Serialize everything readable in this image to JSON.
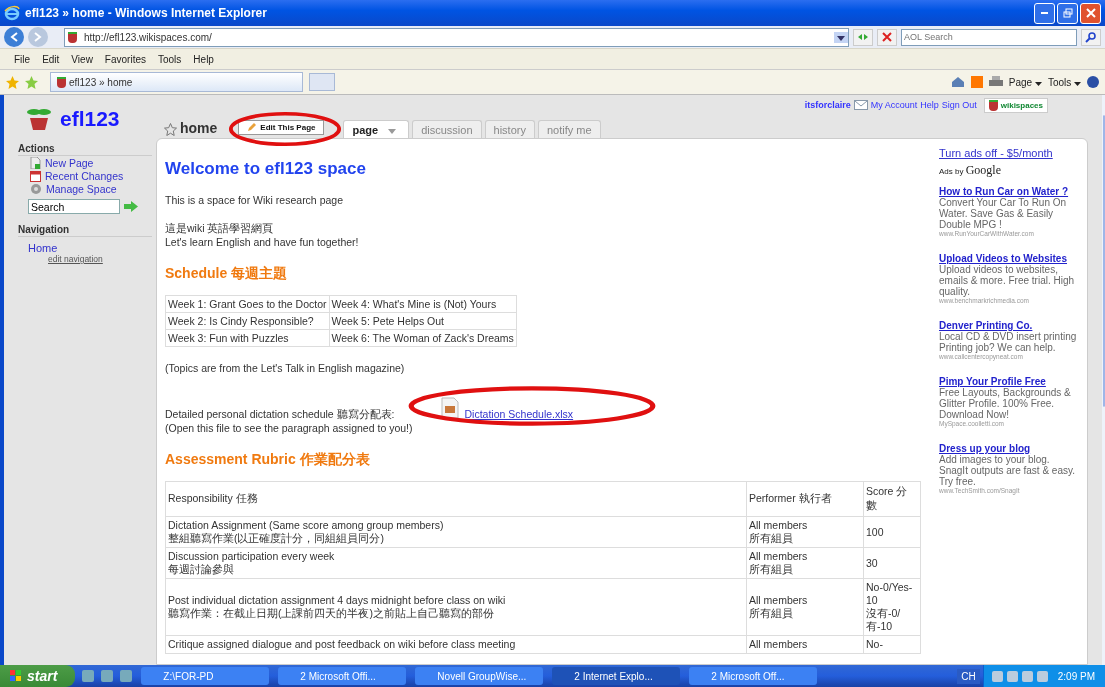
{
  "window": {
    "title": "efl123 » home - Windows Internet Explorer"
  },
  "address_bar": {
    "url": "http://efl123.wikispaces.com/",
    "search_placeholder": "AOL Search"
  },
  "menu": [
    "File",
    "Edit",
    "View",
    "Favorites",
    "Tools",
    "Help"
  ],
  "browser_tab": {
    "title": "efl123 » home"
  },
  "command_bar": [
    "Page",
    "Tools"
  ],
  "site": {
    "logo": "efl123",
    "user": "itsforclaire",
    "links": [
      "My Account",
      "Help",
      "Sign Out"
    ],
    "badge": "wikispaces"
  },
  "page_header": {
    "title": "home",
    "edit_button": "Edit This Page"
  },
  "page_tabs": [
    {
      "label": "page",
      "selected": true,
      "dropdown": true
    },
    {
      "label": "discussion",
      "selected": false,
      "dropdown": false
    },
    {
      "label": "history",
      "selected": false,
      "dropdown": false
    },
    {
      "label": "notify me",
      "selected": false,
      "dropdown": false
    }
  ],
  "sidebar": {
    "actions_heading": "Actions",
    "actions": [
      {
        "label": "New Page",
        "kind": "page"
      },
      {
        "label": "Recent Changes",
        "kind": "calendar"
      },
      {
        "label": "Manage Space",
        "kind": "gear"
      }
    ],
    "search_value": "Search",
    "navigation_heading": "Navigation",
    "nav_link": "Home",
    "edit_link": "edit navigation"
  },
  "content": {
    "heading": "Welcome to efl123 space",
    "intro": "This is a space for Wiki research page",
    "intro_zh": "這是wiki 英語學習網頁",
    "intro_2": "Let's learn English and have fun together!",
    "schedule_heading": "Schedule 每週主題",
    "schedule": [
      [
        "Week 1: Grant Goes to the Doctor",
        "Week 4: What's Mine is (Not) Yours"
      ],
      [
        "Week 2: Is Cindy Responsible?",
        "Week 5: Pete Helps Out"
      ],
      [
        "Week 3: Fun with Puzzles",
        "Week 6: The Woman of Zack's Dreams"
      ]
    ],
    "topics_note": "(Topics are from the Let's Talk in English magazine)",
    "dictation_text": "Detailed personal dictation schedule 聽寫分配表:",
    "dictation_link": "Dictation Schedule.xlsx",
    "dictation_note": "(Open this file to see the paragraph assigned to you!)",
    "rubric_heading": "Assessment Rubric 作業配分表",
    "rubric_columns": [
      "Responsibility 任務",
      "Performer 執行者",
      "Score 分數"
    ],
    "rubric_rows": [
      {
        "task": [
          "Dictation Assignment (Same score among group members)",
          "整組聽寫作業(以正確度計分，同組組員同分)"
        ],
        "performer": [
          "All members",
          "所有組員"
        ],
        "score": [
          "100"
        ]
      },
      {
        "task": [
          "Discussion participation every week",
          "每週討論參與"
        ],
        "performer": [
          "All members",
          "所有組員"
        ],
        "score": [
          "30"
        ]
      },
      {
        "task": [
          "Post individual dictation assignment 4 days midnight before class on wiki",
          "聽寫作業：在截止日期(上課前四天的半夜)之前貼上自己聽寫的部份"
        ],
        "performer": [
          "All members",
          "所有組員"
        ],
        "score": [
          "No-0/Yes-10",
          "沒有-0/有-10"
        ]
      },
      {
        "task": [
          "Critique assigned dialogue and post feedback on wiki before class meeting"
        ],
        "performer": [
          "All members"
        ],
        "score": [
          "No-"
        ]
      }
    ]
  },
  "ads": {
    "turn_off": "Turn ads off - $5/month",
    "ads_by": "Ads by",
    "google": "Google",
    "items": [
      {
        "title": "How to Run Car on Water ?",
        "body": "Convert Your Car To Run On Water. Save Gas & Easily Double MPG !",
        "url": "www.RunYourCarWithWater.com"
      },
      {
        "title": "Upload Videos to Websites",
        "body": "Upload videos to websites, emails & more. Free trial. High quality.",
        "url": "www.benchmarkrichmedia.com"
      },
      {
        "title": "Denver Printing Co.",
        "body": "Local CD & DVD insert printing Printing job? We can help.",
        "url": "www.callcentercopyneat.com"
      },
      {
        "title": "Pimp Your Profile Free",
        "body": "Free Layouts, Backgrounds & Glitter Profile. 100% Free. Download Now!",
        "url": "MySpace.coolletti.com"
      },
      {
        "title": "Dress up your blog",
        "body": "Add images to your blog. SnagIt outputs are fast & easy. Try free.",
        "url": "www.TechSmith.com/SnagIt"
      }
    ]
  },
  "taskbar": {
    "start": "start",
    "items": [
      {
        "label": "Z:\\FOR-PD",
        "selected": false
      },
      {
        "label": "2 Microsoft Offi...",
        "selected": false
      },
      {
        "label": "Novell GroupWise...",
        "selected": false
      },
      {
        "label": "2 Internet Explo...",
        "selected": true
      },
      {
        "label": "2 Microsoft Off...",
        "selected": false
      }
    ],
    "language": "CH",
    "time": "2:09 PM"
  }
}
